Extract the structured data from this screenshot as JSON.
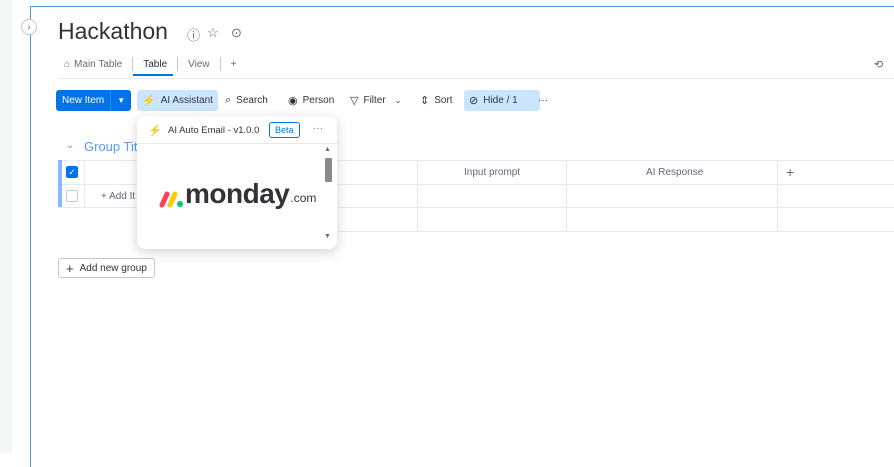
{
  "board": {
    "title": "Hackathon",
    "collapse_glyph": "›",
    "title_icons": [
      "info-icon",
      "star-icon",
      "activity-icon"
    ]
  },
  "view_tabs": [
    {
      "label": "Main Table",
      "icon": "home-icon"
    },
    {
      "label": "Table"
    },
    {
      "label": "View"
    },
    {
      "label": "+"
    }
  ],
  "toolbar": {
    "new_item": "New Item",
    "ai_assistant": "AI Assistant",
    "search": "Search",
    "person": "Person",
    "filter": "Filter",
    "sort": "Sort",
    "hide": "Hide / 1",
    "more": "···"
  },
  "group": {
    "title": "Group Tit",
    "color": "#579bfc",
    "columns": [
      "Input prompt",
      "AI Response"
    ],
    "add_item": "+ Add It",
    "add_col": "+"
  },
  "add_new_group": "Add new group",
  "popup": {
    "title": "AI Auto Email - v1.0.0",
    "badge": "Beta",
    "more": "···",
    "brand_word": "monday",
    "brand_suffix": ".com"
  },
  "colors": {
    "primary": "#0073ea",
    "group": "#579bfc",
    "selected_bg": "#cce5ff"
  }
}
